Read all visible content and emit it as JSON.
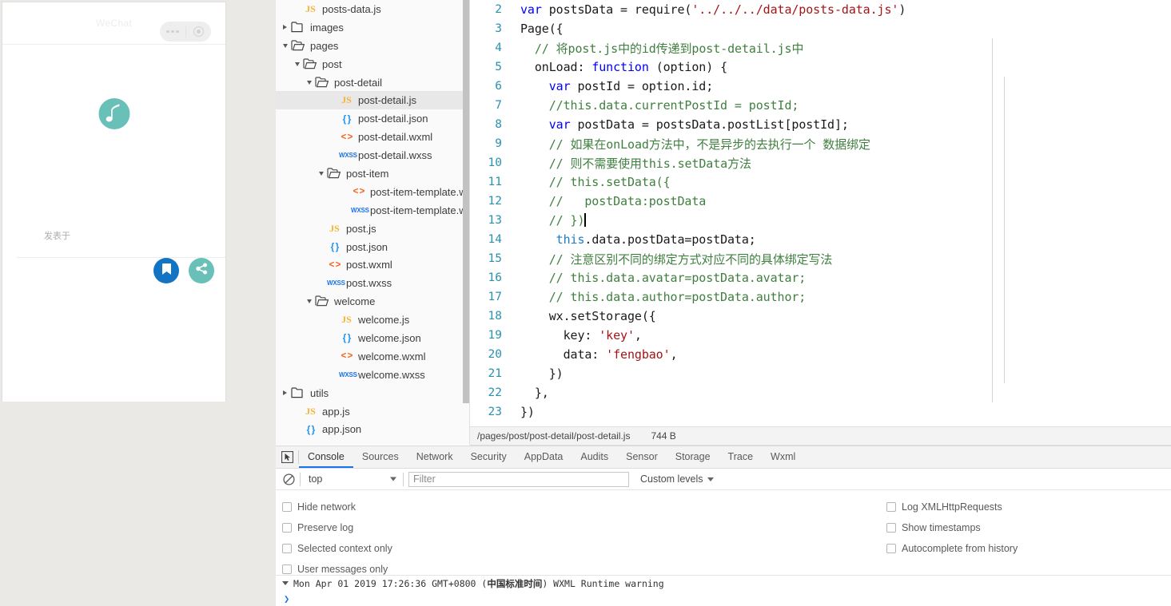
{
  "simulator": {
    "title": "WeChat",
    "capsule": {
      "more_icon": "more-dots-icon",
      "target_icon": "target-circle-icon"
    },
    "logo_icon": "music-note-logo",
    "published_label": "发表于",
    "bookmark_icon": "bookmark-icon",
    "share_icon": "share-icon",
    "colors": {
      "logo": "#68c0b8",
      "bookmark_bg": "#1474c4",
      "share_bg": "#68c0b8"
    }
  },
  "filetree": {
    "rows": [
      {
        "indent": 2,
        "arrow": "none",
        "icon": "js",
        "label": "posts-data.js",
        "selected": false
      },
      {
        "indent": 1,
        "arrow": "closed",
        "icon": "folder",
        "label": "images",
        "selected": false
      },
      {
        "indent": 1,
        "arrow": "open",
        "icon": "folder-open",
        "label": "pages",
        "selected": false
      },
      {
        "indent": 2,
        "arrow": "open",
        "icon": "folder-open",
        "label": "post",
        "selected": false
      },
      {
        "indent": 3,
        "arrow": "open",
        "icon": "folder-open",
        "label": "post-detail",
        "selected": false
      },
      {
        "indent": 5,
        "arrow": "none",
        "icon": "js",
        "label": "post-detail.js",
        "selected": true
      },
      {
        "indent": 5,
        "arrow": "none",
        "icon": "json",
        "label": "post-detail.json",
        "selected": false
      },
      {
        "indent": 5,
        "arrow": "none",
        "icon": "wxml",
        "label": "post-detail.wxml",
        "selected": false
      },
      {
        "indent": 5,
        "arrow": "none",
        "icon": "wxss",
        "label": "post-detail.wxss",
        "selected": false
      },
      {
        "indent": 4,
        "arrow": "open",
        "icon": "folder-open",
        "label": "post-item",
        "selected": false
      },
      {
        "indent": 6,
        "arrow": "none",
        "icon": "wxml",
        "label": "post-item-template.wxml",
        "selected": false
      },
      {
        "indent": 6,
        "arrow": "none",
        "icon": "wxss",
        "label": "post-item-template.wxss",
        "selected": false
      },
      {
        "indent": 4,
        "arrow": "none",
        "icon": "js",
        "label": "post.js",
        "selected": false
      },
      {
        "indent": 4,
        "arrow": "none",
        "icon": "json",
        "label": "post.json",
        "selected": false
      },
      {
        "indent": 4,
        "arrow": "none",
        "icon": "wxml",
        "label": "post.wxml",
        "selected": false
      },
      {
        "indent": 4,
        "arrow": "none",
        "icon": "wxss",
        "label": "post.wxss",
        "selected": false
      },
      {
        "indent": 3,
        "arrow": "open",
        "icon": "folder-open",
        "label": "welcome",
        "selected": false
      },
      {
        "indent": 5,
        "arrow": "none",
        "icon": "js",
        "label": "welcome.js",
        "selected": false
      },
      {
        "indent": 5,
        "arrow": "none",
        "icon": "json",
        "label": "welcome.json",
        "selected": false
      },
      {
        "indent": 5,
        "arrow": "none",
        "icon": "wxml",
        "label": "welcome.wxml",
        "selected": false
      },
      {
        "indent": 5,
        "arrow": "none",
        "icon": "wxss",
        "label": "welcome.wxss",
        "selected": false
      },
      {
        "indent": 1,
        "arrow": "closed",
        "icon": "folder",
        "label": "utils",
        "selected": false
      },
      {
        "indent": 2,
        "arrow": "none",
        "icon": "js",
        "label": "app.js",
        "selected": false
      },
      {
        "indent": 2,
        "arrow": "none",
        "icon": "json",
        "label": "app.json",
        "selected": false
      }
    ]
  },
  "editor": {
    "first_line_number": 2,
    "lines": [
      {
        "n": 2,
        "tokens": [
          {
            "t": "kw",
            "v": "var"
          },
          {
            "t": "plain",
            "v": " postsData = require("
          },
          {
            "t": "str",
            "v": "'../../../data/posts-data.js'"
          },
          {
            "t": "plain",
            "v": ")"
          }
        ]
      },
      {
        "n": 3,
        "tokens": [
          {
            "t": "plain",
            "v": "Page({"
          }
        ]
      },
      {
        "n": 4,
        "tokens": [
          {
            "t": "com",
            "v": "  // 将post.js中的id传递到post-detail.js中"
          }
        ]
      },
      {
        "n": 5,
        "tokens": [
          {
            "t": "plain",
            "v": "  onLoad: "
          },
          {
            "t": "kw",
            "v": "function"
          },
          {
            "t": "plain",
            "v": " (option) {"
          }
        ]
      },
      {
        "n": 6,
        "tokens": [
          {
            "t": "plain",
            "v": "    "
          },
          {
            "t": "kw",
            "v": "var"
          },
          {
            "t": "plain",
            "v": " postId = option.id;"
          }
        ]
      },
      {
        "n": 7,
        "tokens": [
          {
            "t": "com",
            "v": "    //this.data.currentPostId = postId;"
          }
        ]
      },
      {
        "n": 8,
        "tokens": [
          {
            "t": "plain",
            "v": "    "
          },
          {
            "t": "kw",
            "v": "var"
          },
          {
            "t": "plain",
            "v": " postData = postsData.postList[postId];"
          }
        ]
      },
      {
        "n": 9,
        "tokens": [
          {
            "t": "com",
            "v": "    // 如果在onLoad方法中，不是异步的去执行一个 数据绑定"
          }
        ]
      },
      {
        "n": 10,
        "tokens": [
          {
            "t": "com",
            "v": "    // 则不需要使用this.setData方法"
          }
        ]
      },
      {
        "n": 11,
        "tokens": [
          {
            "t": "com",
            "v": "    // this.setData({"
          }
        ]
      },
      {
        "n": 12,
        "tokens": [
          {
            "t": "com",
            "v": "    //   postData:postData"
          }
        ]
      },
      {
        "n": 13,
        "tokens": [
          {
            "t": "com",
            "v": "    // })"
          },
          {
            "t": "caret",
            "v": ""
          }
        ]
      },
      {
        "n": 14,
        "tokens": [
          {
            "t": "plain",
            "v": "     "
          },
          {
            "t": "this",
            "v": "this"
          },
          {
            "t": "plain",
            "v": ".data.postData=postData;"
          }
        ]
      },
      {
        "n": 15,
        "tokens": [
          {
            "t": "com",
            "v": "    // 注意区别不同的绑定方式对应不同的具体绑定写法"
          }
        ]
      },
      {
        "n": 16,
        "tokens": [
          {
            "t": "com",
            "v": "    // this.data.avatar=postData.avatar;"
          }
        ]
      },
      {
        "n": 17,
        "tokens": [
          {
            "t": "com",
            "v": "    // this.data.author=postData.author;"
          }
        ]
      },
      {
        "n": 18,
        "tokens": [
          {
            "t": "plain",
            "v": "    wx.setStorage({"
          }
        ]
      },
      {
        "n": 19,
        "tokens": [
          {
            "t": "plain",
            "v": "      key: "
          },
          {
            "t": "str",
            "v": "'key'"
          },
          {
            "t": "plain",
            "v": ","
          }
        ]
      },
      {
        "n": 20,
        "tokens": [
          {
            "t": "plain",
            "v": "      data: "
          },
          {
            "t": "str",
            "v": "'fengbao'"
          },
          {
            "t": "plain",
            "v": ","
          }
        ]
      },
      {
        "n": 21,
        "tokens": [
          {
            "t": "plain",
            "v": "    })"
          }
        ]
      },
      {
        "n": 22,
        "tokens": [
          {
            "t": "plain",
            "v": "  },"
          }
        ]
      },
      {
        "n": 23,
        "tokens": [
          {
            "t": "plain",
            "v": "})"
          }
        ]
      }
    ]
  },
  "editor_status": {
    "path": "/pages/post/post-detail/post-detail.js",
    "size": "744 B"
  },
  "devtools": {
    "inspect_icon": "inspect-element-icon",
    "tabs": [
      {
        "label": "Console",
        "active": true
      },
      {
        "label": "Sources",
        "active": false
      },
      {
        "label": "Network",
        "active": false
      },
      {
        "label": "Security",
        "active": false
      },
      {
        "label": "AppData",
        "active": false
      },
      {
        "label": "Audits",
        "active": false
      },
      {
        "label": "Sensor",
        "active": false
      },
      {
        "label": "Storage",
        "active": false
      },
      {
        "label": "Trace",
        "active": false
      },
      {
        "label": "Wxml",
        "active": false
      }
    ],
    "clear_icon": "clear-console-icon",
    "context_value": "top",
    "filter_placeholder": "Filter",
    "filter_value": "",
    "levels_label": "Custom levels",
    "options_left": [
      {
        "label": "Hide network",
        "checked": false
      },
      {
        "label": "Preserve log",
        "checked": false
      },
      {
        "label": "Selected context only",
        "checked": false
      },
      {
        "label": "User messages only",
        "checked": false
      }
    ],
    "options_right": [
      {
        "label": "Log XMLHttpRequests",
        "checked": false
      },
      {
        "label": "Show timestamps",
        "checked": false
      },
      {
        "label": "Autocomplete from history",
        "checked": false
      }
    ],
    "console_message": {
      "date": "Mon Apr 01 2019 17:26:36 GMT+0800 (",
      "tz_cn": "中国标准时间",
      "tail": ") WXML Runtime warning"
    },
    "prompt": "❯"
  },
  "accent_color": "#1a73e8"
}
